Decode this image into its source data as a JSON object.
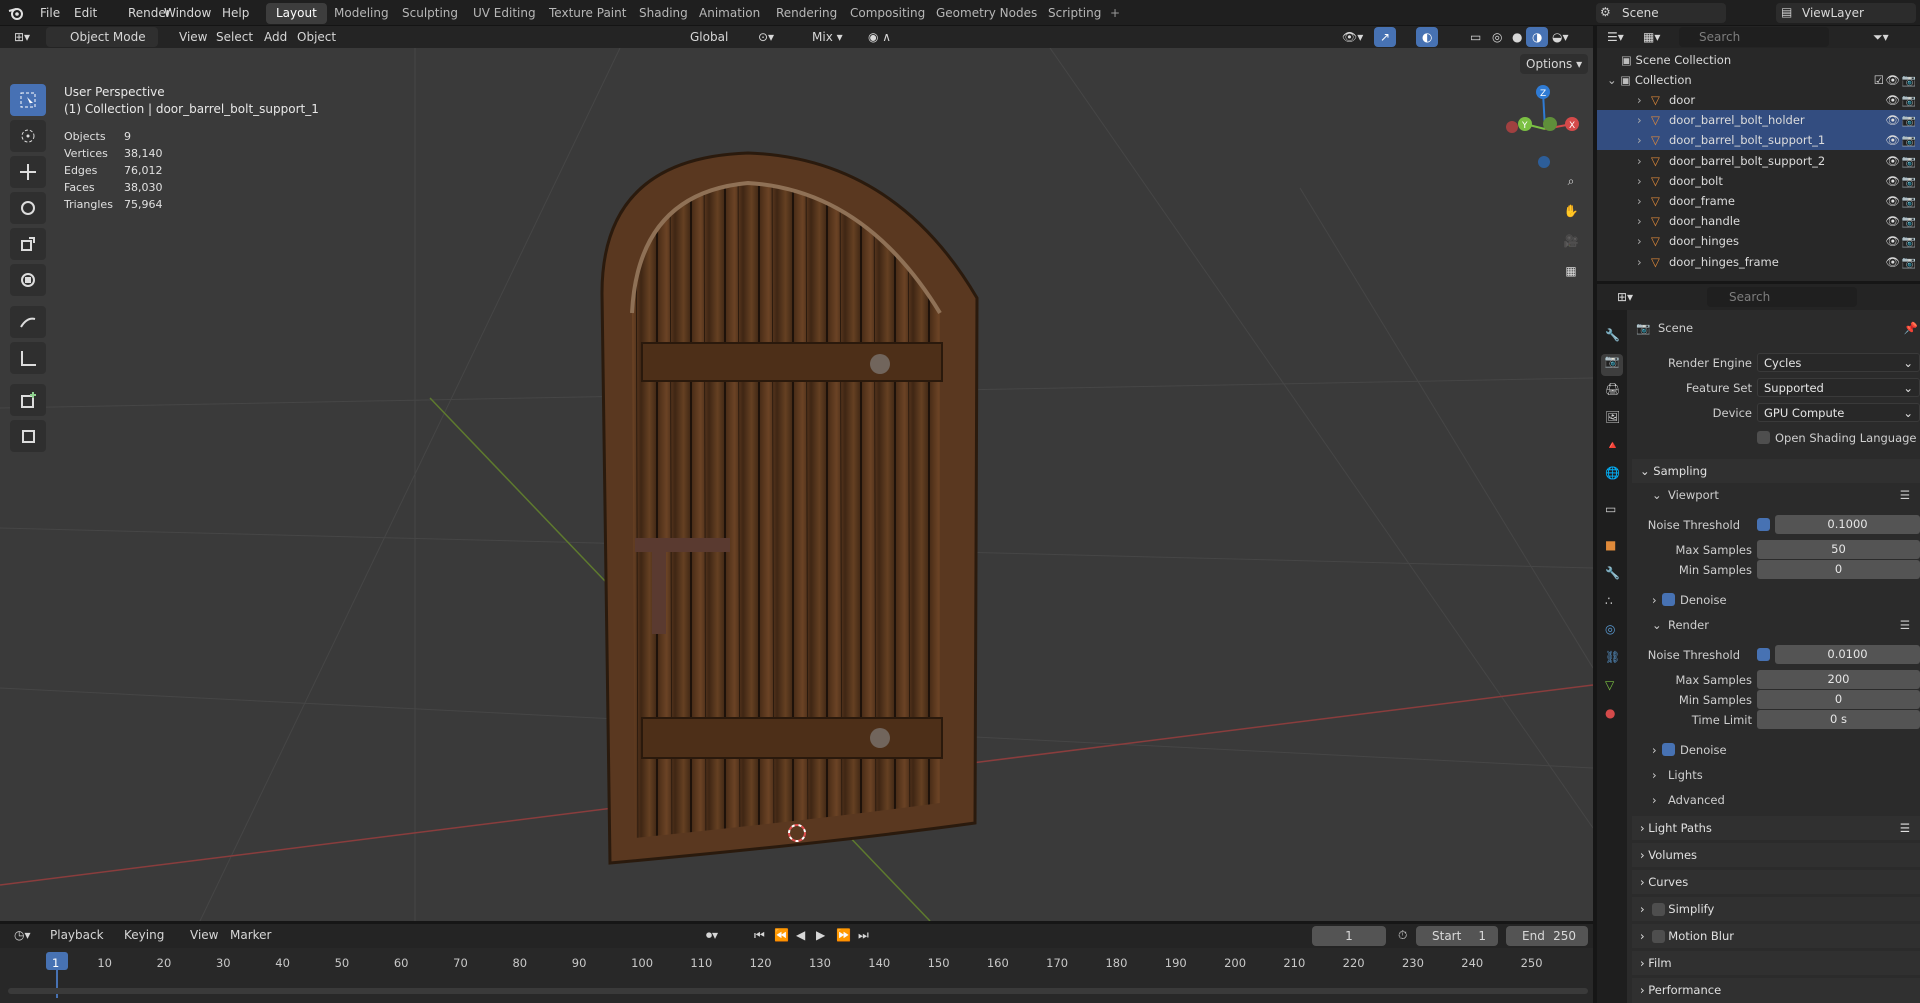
{
  "topbar": {
    "menus": [
      "File",
      "Edit",
      "Render",
      "Window",
      "Help"
    ],
    "workspaces": [
      "Layout",
      "Modeling",
      "Sculpting",
      "UV Editing",
      "Texture Paint",
      "Shading",
      "Animation",
      "Rendering",
      "Compositing",
      "Geometry Nodes",
      "Scripting"
    ],
    "active_workspace": "Layout",
    "scene": "Scene",
    "view_layer": "ViewLayer"
  },
  "viewport_header": {
    "mode": "Object Mode",
    "menus": [
      "View",
      "Select",
      "Add",
      "Object"
    ],
    "orientation": "Global",
    "snap_mode": "Mix",
    "options": "Options"
  },
  "viewport": {
    "perspective": "User Perspective",
    "collection_line": "(1) Collection | door_barrel_bolt_support_1",
    "stats": [
      {
        "label": "Objects",
        "value": "9"
      },
      {
        "label": "Vertices",
        "value": "38,140"
      },
      {
        "label": "Edges",
        "value": "76,012"
      },
      {
        "label": "Faces",
        "value": "38,030"
      },
      {
        "label": "Triangles",
        "value": "75,964"
      }
    ],
    "gizmo_axes": [
      "Z",
      "Y",
      "X"
    ]
  },
  "outliner": {
    "search_placeholder": "Search",
    "root": "Scene Collection",
    "collection": "Collection",
    "items": [
      {
        "name": "door",
        "selected": false
      },
      {
        "name": "door_barrel_bolt_holder",
        "selected": true
      },
      {
        "name": "door_barrel_bolt_support_1",
        "selected": true
      },
      {
        "name": "door_barrel_bolt_support_2",
        "selected": false
      },
      {
        "name": "door_bolt",
        "selected": false
      },
      {
        "name": "door_frame",
        "selected": false
      },
      {
        "name": "door_handle",
        "selected": false
      },
      {
        "name": "door_hinges",
        "selected": false
      },
      {
        "name": "door_hinges_frame",
        "selected": false
      }
    ]
  },
  "properties": {
    "search_placeholder": "Search",
    "context": "Scene",
    "render_engine_label": "Render Engine",
    "render_engine": "Cycles",
    "feature_set_label": "Feature Set",
    "feature_set": "Supported",
    "device_label": "Device",
    "device": "GPU Compute",
    "osl_label": "Open Shading Language",
    "sampling": "Sampling",
    "viewport": "Viewport",
    "render": "Render",
    "noise_threshold_label": "Noise Threshold",
    "max_samples_label": "Max Samples",
    "min_samples_label": "Min Samples",
    "time_limit_label": "Time Limit",
    "denoise_label": "Denoise",
    "viewport_noise_threshold": "0.1000",
    "viewport_max_samples": "50",
    "viewport_min_samples": "0",
    "render_noise_threshold": "0.0100",
    "render_max_samples": "200",
    "render_min_samples": "0",
    "render_time_limit": "0 s",
    "sub_panels": [
      "Lights",
      "Advanced"
    ],
    "panels": [
      "Light Paths",
      "Volumes",
      "Curves",
      "Simplify",
      "Motion Blur",
      "Film",
      "Performance"
    ]
  },
  "timeline": {
    "menus": [
      "Playback",
      "Keying",
      "View",
      "Marker"
    ],
    "current_frame": "1",
    "start_label": "Start",
    "start": "1",
    "end_label": "End",
    "end": "250",
    "ticks": [
      "1",
      "10",
      "20",
      "30",
      "40",
      "50",
      "60",
      "70",
      "80",
      "90",
      "100",
      "110",
      "120",
      "130",
      "140",
      "150",
      "160",
      "170",
      "180",
      "190",
      "200",
      "210",
      "220",
      "230",
      "240",
      "250"
    ]
  }
}
